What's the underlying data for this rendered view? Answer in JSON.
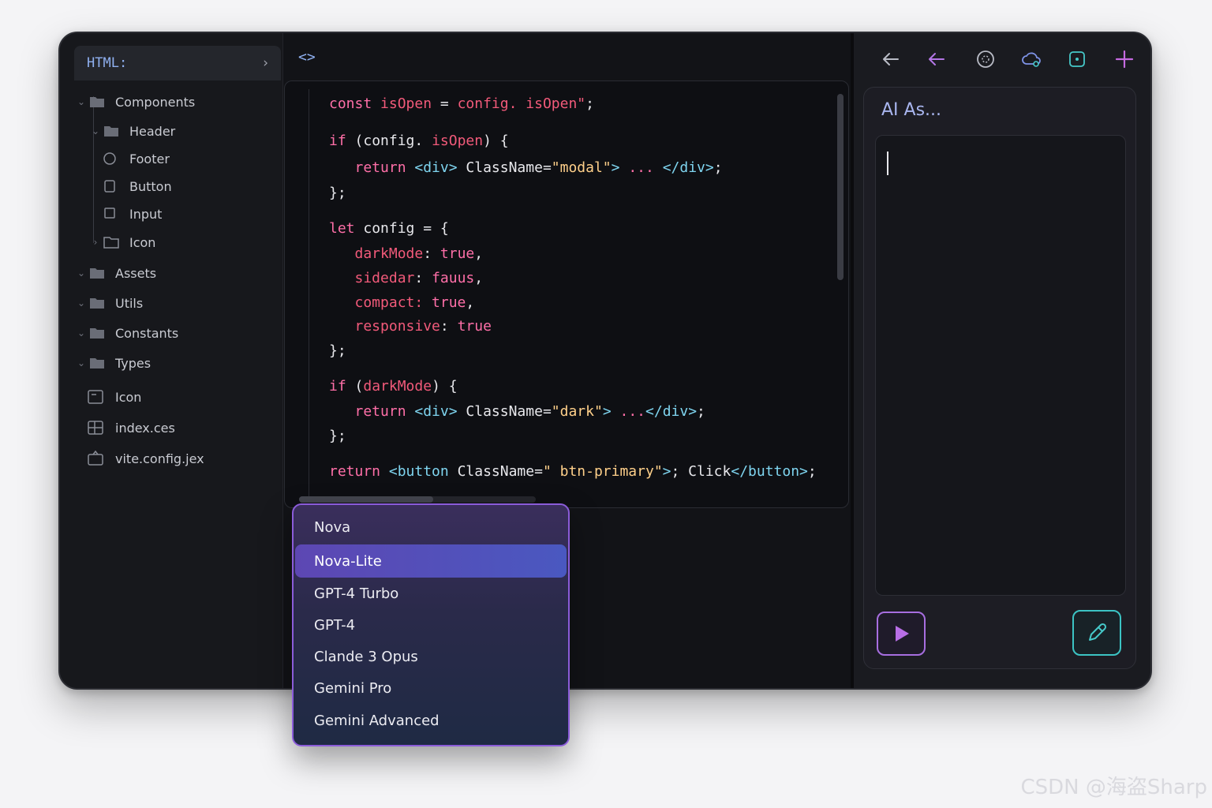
{
  "sidebar": {
    "tab_label": "HTML:",
    "tree": [
      {
        "label": "Components",
        "icon": "folder-icon",
        "expanded": true
      },
      {
        "label": "Header",
        "icon": "folder-icon",
        "expanded": true
      },
      {
        "label": "Footer",
        "icon": "circle-icon"
      },
      {
        "label": "Button",
        "icon": "square-icon"
      },
      {
        "label": "Input",
        "icon": "square-icon"
      },
      {
        "label": "Icon",
        "icon": "folder-outline-icon",
        "expanded": false
      },
      {
        "label": "Assets",
        "icon": "folder-icon",
        "expanded": true
      },
      {
        "label": "Utils",
        "icon": "folder-icon",
        "expanded": true
      },
      {
        "label": "Constants",
        "icon": "folder-icon",
        "expanded": true
      },
      {
        "label": "Types",
        "icon": "folder-icon",
        "expanded": true
      },
      {
        "label": "Icon",
        "icon": "window-icon"
      },
      {
        "label": "index.ces",
        "icon": "grid-file-icon"
      },
      {
        "label": "vite.config.jex",
        "icon": "package-icon"
      }
    ]
  },
  "editor": {
    "tab_icon": "<>",
    "code": [
      [
        [
          "kw",
          "const "
        ],
        [
          "pr",
          "isOpen"
        ],
        [
          "d",
          " = "
        ],
        [
          "pr",
          "config. isOpen\""
        ],
        [
          "d",
          ";"
        ]
      ],
      [
        [
          "kw",
          "if "
        ],
        [
          "d",
          "(config. "
        ],
        [
          "pr",
          "isOpen"
        ],
        [
          "d",
          ") {"
        ]
      ],
      [
        [
          "kw",
          "   return "
        ],
        [
          "tg",
          "<div> "
        ],
        [
          "d",
          "ClassName="
        ],
        [
          "st",
          "\"modal\""
        ],
        [
          "tg",
          "> "
        ],
        [
          "kw",
          "... "
        ],
        [
          "tg",
          "</div>"
        ],
        [
          "d",
          ";"
        ]
      ],
      [
        [
          "d",
          "};"
        ]
      ],
      [
        [
          "kw",
          "let "
        ],
        [
          "d",
          "config = {"
        ]
      ],
      [
        [
          "pr",
          "   darkMode"
        ],
        [
          "d",
          ": "
        ],
        [
          "kw",
          "true"
        ],
        [
          "d",
          ","
        ]
      ],
      [
        [
          "pr",
          "   sidedar"
        ],
        [
          "d",
          ": "
        ],
        [
          "kw",
          "fauus"
        ],
        [
          "d",
          ","
        ]
      ],
      [
        [
          "pr",
          "   compact: "
        ],
        [
          "kw",
          "true"
        ],
        [
          "d",
          ","
        ]
      ],
      [
        [
          "pr",
          "   responsive"
        ],
        [
          "d",
          ": "
        ],
        [
          "kw",
          "true"
        ]
      ],
      [
        [
          "d",
          "};"
        ]
      ],
      [
        [
          "kw",
          "if "
        ],
        [
          "d",
          "("
        ],
        [
          "pr",
          "darkMode"
        ],
        [
          "d",
          ") {"
        ]
      ],
      [
        [
          "kw",
          "   return "
        ],
        [
          "tg",
          "<div> "
        ],
        [
          "d",
          "ClassName="
        ],
        [
          "st",
          "\"dark\""
        ],
        [
          "tg",
          "> "
        ],
        [
          "kw",
          "..."
        ],
        [
          "tg",
          "</div>"
        ],
        [
          "d",
          ";"
        ]
      ],
      [
        [
          "d",
          "};"
        ]
      ],
      [
        [
          "kw",
          "return "
        ],
        [
          "tg",
          "<button "
        ],
        [
          "d",
          "ClassName="
        ],
        [
          "st",
          "\" btn-primary\""
        ],
        [
          "tg",
          ">"
        ],
        [
          "d",
          "; Click"
        ],
        [
          "tg",
          "</button>"
        ],
        [
          "d",
          ";"
        ]
      ]
    ]
  },
  "ai_panel": {
    "title": "AI As...",
    "toolbar_icons": [
      "arrow-left-icon",
      "arrow-left-icon",
      "globe-icon",
      "cloud-icon",
      "square-dot-icon",
      "plus-icon"
    ]
  },
  "model_dropdown": {
    "options": [
      "Nova",
      "Nova-Lite",
      "GPT-4 Turbo",
      "GPT-4",
      "Clande 3 Opus",
      "Gemini Pro",
      "Gemini Advanced"
    ],
    "selected": "Nova-Lite"
  },
  "watermark": "CSDN @海盗Sharp",
  "colors": {
    "keyword": "#ff6fa8",
    "property": "#f25a7a",
    "tag": "#7fd5f0",
    "string": "#ffd08a",
    "accent_purple": "#a76ee0",
    "accent_teal": "#3cc4c4"
  }
}
